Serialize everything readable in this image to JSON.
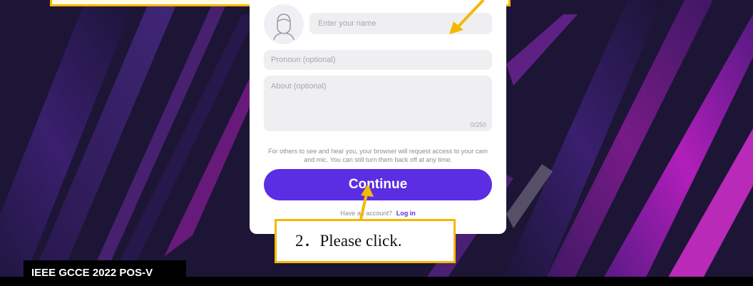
{
  "form": {
    "name_placeholder": "Enter your name",
    "pronoun_placeholder": "Pronoun (optional)",
    "about_placeholder": "About (optional)",
    "about_counter": "0/250",
    "notice": "For others to see and hear you, your browser will request access to your cam and mic. You can still turn them back off at any time.",
    "continue_label": "Continue",
    "account_prompt": "Have an account?",
    "login_label": "Log in"
  },
  "annotation": {
    "callout_text": "2．Please click.",
    "highlight_color": "#f5b800"
  },
  "footer": {
    "conference_label": "IEEE GCCE 2022 POS-V"
  },
  "colors": {
    "accent": "#5b2de3",
    "background": "#17122e",
    "magenta": "#c21fc9"
  }
}
